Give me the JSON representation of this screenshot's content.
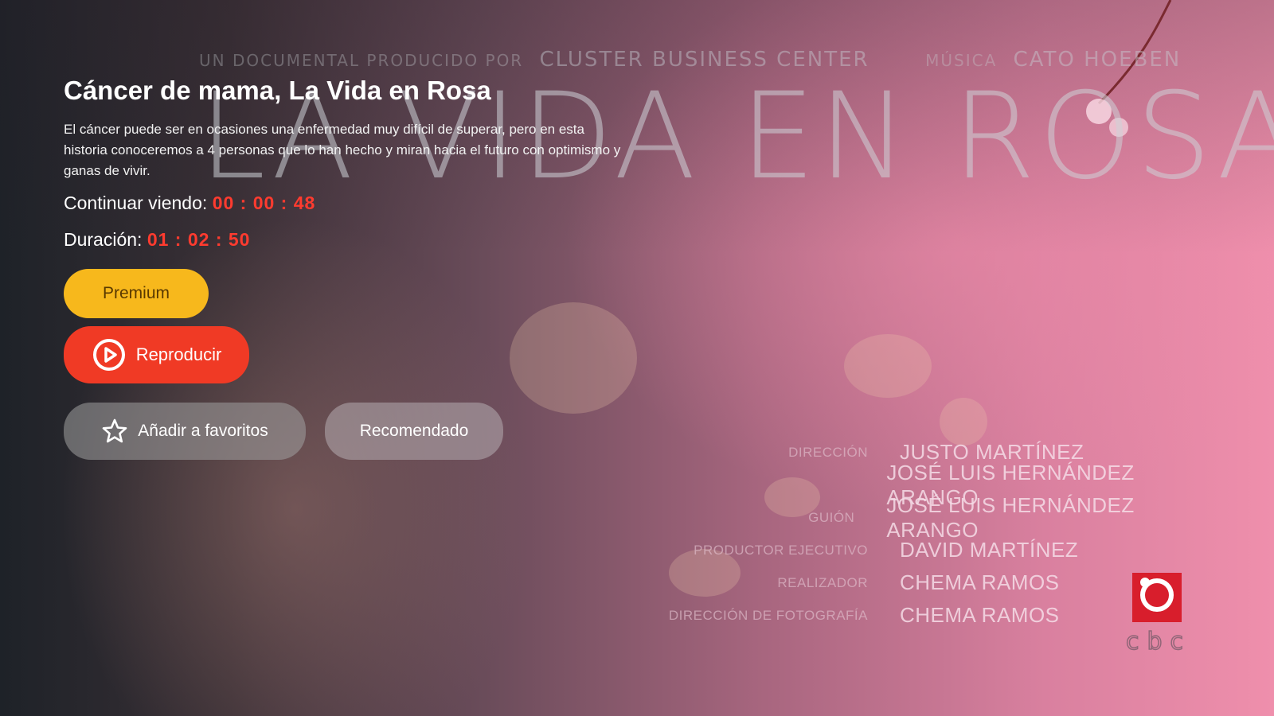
{
  "poster": {
    "produced_by_label": "UN DOCUMENTAL PRODUCIDO POR",
    "producer": "CLUSTER BUSINESS CENTER",
    "music_label": "MÚSICA",
    "composer": "CATO HOEBEN",
    "title": "LA VIDA EN ROSA",
    "credits": [
      {
        "role": "DIRECCIÓN",
        "name": "JUSTO MARTÍNEZ"
      },
      {
        "role": "",
        "name": "JOSÉ LUIS HERNÁNDEZ ARANGO"
      },
      {
        "role": "GUIÓN",
        "name": "JOSÉ LUIS HERNÁNDEZ ARANGO"
      },
      {
        "role": "PRODUCTOR EJECUTIVO",
        "name": "DAVID MARTÍNEZ"
      },
      {
        "role": "REALIZADOR",
        "name": "CHEMA RAMOS"
      },
      {
        "role": "DIRECCIÓN DE FOTOGRAFÍA",
        "name": "CHEMA RAMOS"
      }
    ],
    "logo_text": "cbc"
  },
  "detail": {
    "title": "Cáncer de mama, La Vida en Rosa",
    "description": "El cáncer puede ser en ocasiones una enfermedad muy difícil de superar, pero en esta historia conoceremos a 4 personas que lo han hecho y miran hacia el futuro con optimismo y ganas de vivir.",
    "continue_label": "Continuar viendo: ",
    "continue_time": "00 : 00 : 48",
    "duration_label": "Duración: ",
    "duration_time": "01 : 02 : 50"
  },
  "buttons": {
    "premium": "Premium",
    "play": "Reproducir",
    "favorite": "Añadir a favoritos",
    "recommended": "Recomendado"
  },
  "icons": {
    "play": "play-circle-icon",
    "favorite": "star-outline-icon"
  },
  "colors": {
    "accent_red": "#f03a25",
    "time_red": "#ff3b2f",
    "premium_yellow": "#f7b81c"
  }
}
